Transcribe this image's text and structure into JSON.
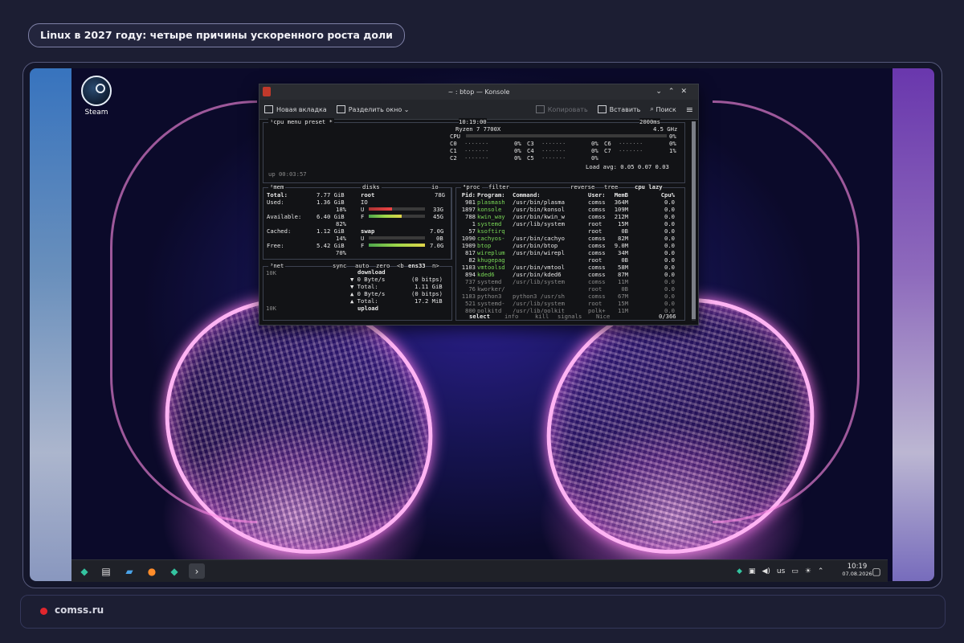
{
  "headline": "Linux в 2027 году: четыре причины ускоренного роста доли",
  "desktop": {
    "steam_label": "Steam"
  },
  "konsole": {
    "title": "~ : btop — Konsole",
    "toolbar": {
      "new_tab": "Новая вкладка",
      "split": "Разделить окно",
      "copy": "Копировать",
      "paste": "Вставить",
      "search": "Поиск"
    }
  },
  "btop": {
    "cpu_box": {
      "title": "¹cpu",
      "menu": "menu",
      "preset": "preset *",
      "time": "10:19:00",
      "interval": "2000ms",
      "model": "Ryzen 7 7700X",
      "freq": "4.5 GHz",
      "cores": [
        {
          "label": "CPU",
          "val": "0%"
        },
        {
          "label": "C0",
          "val": "0%"
        },
        {
          "label": "C3",
          "val": "0%"
        },
        {
          "label": "C6",
          "val": "0%"
        },
        {
          "label": "C1",
          "val": "0%"
        },
        {
          "label": "C4",
          "val": "0%"
        },
        {
          "label": "C7",
          "val": "1%"
        },
        {
          "label": "C2",
          "val": "0%"
        },
        {
          "label": "C5",
          "val": "0%"
        }
      ],
      "load_avg": "Load avg: 0.05 0.07 0.03",
      "uptime": "up 00:03:57"
    },
    "mem_box": {
      "title": "²mem",
      "total_l": "Total:",
      "total": "7.77 GiB",
      "used_l": "Used:",
      "used": "1.36 GiB",
      "used_p": "18%",
      "avail_l": "Available:",
      "avail": "6.40 GiB",
      "avail_p": "82%",
      "cached_l": "Cached:",
      "cached": "1.12 GiB",
      "cached_p": "14%",
      "free_l": "Free:",
      "free": "5.42 GiB",
      "free_p": "70%"
    },
    "disks_box": {
      "title": "disks",
      "io": "io",
      "root": "root",
      "root_size": "78G",
      "root_io": "IO",
      "u_l": "U",
      "u": "33G",
      "f_l": "F",
      "f": "45G",
      "swap": "swap",
      "swap_size": "7.0G",
      "su": "0B",
      "sf": "7.0G",
      "u_frac": 0.42,
      "f_frac": 0.58,
      "su_frac": 0.0,
      "sf_frac": 1.0
    },
    "net_box": {
      "title": "³net",
      "sync": "sync",
      "auto": "auto",
      "zero": "zero",
      "b": "<b",
      "iface": "ens33",
      "n": "n>",
      "scale_top": "10K",
      "scale_bot": "10K",
      "download": "download",
      "dl_rate": "0 Byte/s",
      "dl_bits": "(0 bitps)",
      "dl_total_l": "Total:",
      "dl_total": "1.11 GiB",
      "ul_rate": "0 Byte/s",
      "ul_bits": "(0 bitps)",
      "ul_total_l": "Total:",
      "ul_total": "17.2 MiB",
      "upload": "upload"
    },
    "proc_box": {
      "title": "⁴proc",
      "filter": "filter",
      "reverse": "reverse",
      "tree": "tree",
      "cpu_lazy": "cpu lazy",
      "headers": [
        "Pid:",
        "Program:",
        "Command:",
        "User:",
        "MemB",
        "Cpu%"
      ],
      "rows": [
        [
          "981",
          "plasmash",
          "/usr/bin/plasma",
          "comss",
          "364M",
          "0.0"
        ],
        [
          "1897",
          "konsole",
          "/usr/bin/konsol",
          "comss",
          "109M",
          "0.0"
        ],
        [
          "788",
          "kwin_way",
          "/usr/bin/kwin_w",
          "comss",
          "212M",
          "0.0"
        ],
        [
          "1",
          "systemd",
          "/usr/lib/system",
          "root",
          "15M",
          "0.0"
        ],
        [
          "57",
          "ksoftirq",
          "",
          "root",
          "0B",
          "0.0"
        ],
        [
          "1090",
          "cachyos-",
          "/usr/bin/cachyo",
          "comss",
          "82M",
          "0.0"
        ],
        [
          "1909",
          "btop",
          "/usr/bin/btop",
          "comss",
          "9.0M",
          "0.0"
        ],
        [
          "817",
          "wireplum",
          "/usr/bin/wirepl",
          "comss",
          "34M",
          "0.0"
        ],
        [
          "82",
          "khugepag",
          "",
          "root",
          "0B",
          "0.0"
        ],
        [
          "1103",
          "vmtoolsd",
          "/usr/bin/vmtool",
          "comss",
          "58M",
          "0.0"
        ],
        [
          "894",
          "kded6",
          "/usr/bin/kded6",
          "comss",
          "87M",
          "0.0"
        ],
        [
          "737",
          "systemd",
          "/usr/lib/system",
          "comss",
          "11M",
          "0.0"
        ],
        [
          "76",
          "kworker/",
          "",
          "root",
          "0B",
          "0.0"
        ],
        [
          "1183",
          "python3",
          "python3 /usr/sh",
          "comss",
          "67M",
          "0.0"
        ],
        [
          "521",
          "systemd-",
          "/usr/lib/system",
          "root",
          "15M",
          "0.0"
        ],
        [
          "800",
          "polkitd",
          "/usr/lib/polkit",
          "polk+",
          "11M",
          "0.0"
        ]
      ],
      "footer_select": "select",
      "footer_info": "info",
      "footer_kill": "kill",
      "footer_signals": "signals",
      "footer_nice": "Nice",
      "count": "0/366"
    }
  },
  "taskbar": {
    "lang": "us",
    "time": "10:19",
    "date": "07.08.2026"
  },
  "footer": {
    "site": "comss.ru"
  },
  "colors": {
    "background": "#1c1e33",
    "accent_red": "#e0262d",
    "terminal_bg": "#121316",
    "bar_green": "#7ad957"
  }
}
